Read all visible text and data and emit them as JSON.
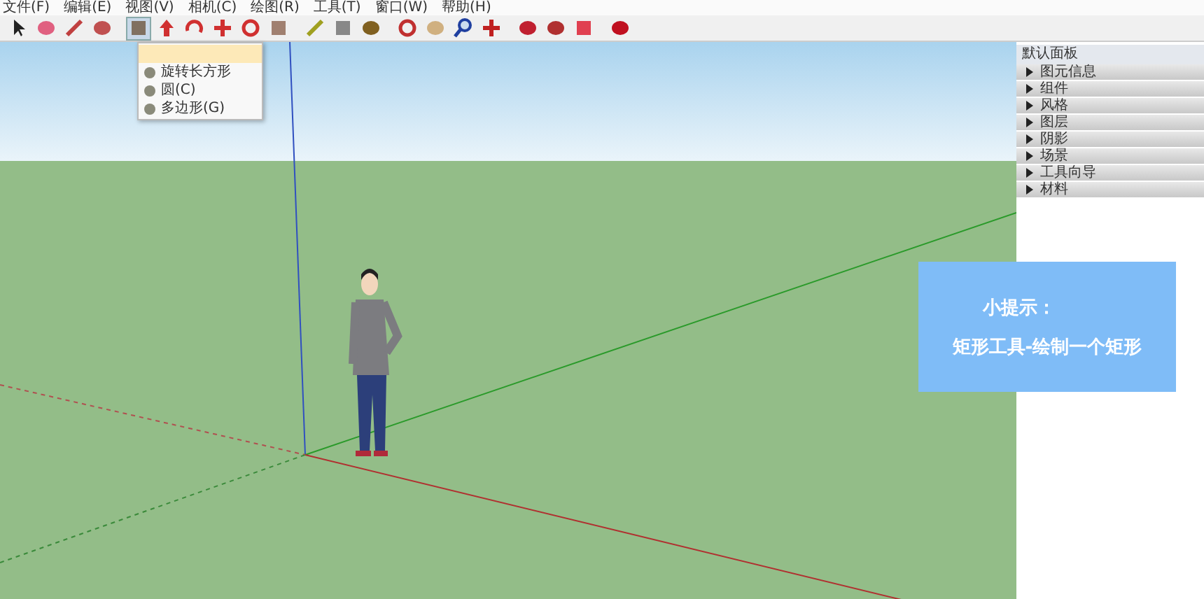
{
  "menu_bar": [
    "文件(F)",
    "编辑(E)",
    "视图(V)",
    "相机(C)",
    "绘图(R)",
    "工具(T)",
    "窗口(W)",
    "帮助(H)"
  ],
  "dropdown": {
    "items": [
      {
        "selected": true
      },
      {
        "label": "旋转长方形",
        "selected": false
      },
      {
        "label": "圆(C)",
        "selected": false
      },
      {
        "label": "多边形(G)",
        "selected": false
      }
    ]
  },
  "panel": {
    "title": "默认面板",
    "trays": [
      {
        "label": "图元信息",
        "expanded": false
      },
      {
        "label": "组件",
        "expanded": false
      },
      {
        "label": "风格",
        "expanded": false
      },
      {
        "label": "图层",
        "expanded": false
      },
      {
        "label": "阴影",
        "expanded": false
      },
      {
        "label": "场景",
        "expanded": false
      },
      {
        "label": "工具向导",
        "expanded": false
      },
      {
        "label": "材料",
        "expanded": false
      }
    ]
  },
  "tip": {
    "title": "小提示：",
    "text": "矩形工具-绘制一个矩形"
  }
}
